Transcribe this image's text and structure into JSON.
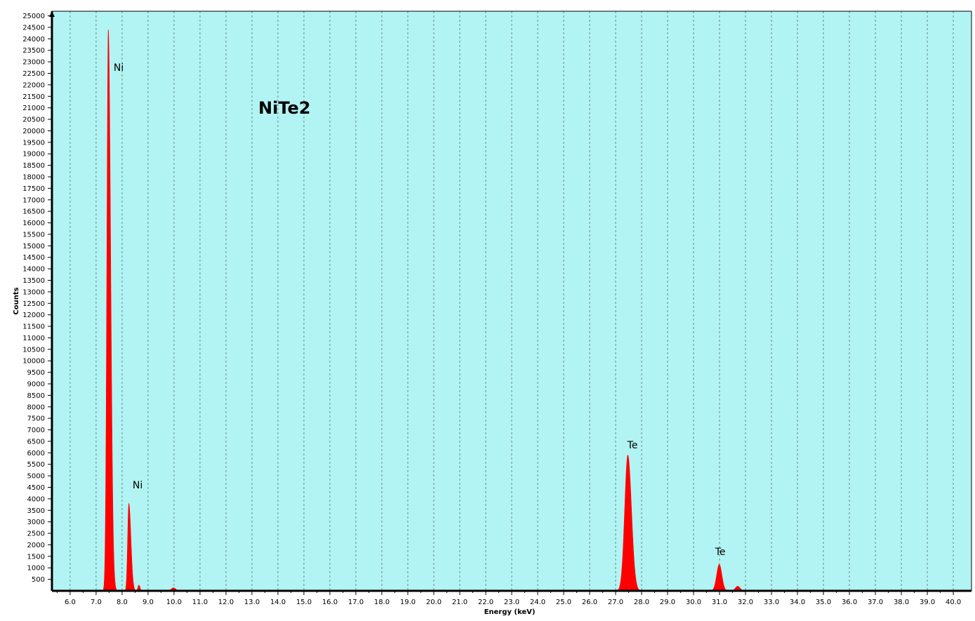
{
  "chart_data": {
    "type": "area",
    "title": "NiTe2",
    "xlabel": "Energy (keV)",
    "ylabel": "Counts",
    "xlim": [
      5.3,
      40.7
    ],
    "ylim": [
      0,
      25200
    ],
    "grid": true,
    "colors": {
      "plot_bg": "#b2f4f4",
      "fill": "#ff0000",
      "grid": "#6a8a8a"
    },
    "x_ticks": [
      "6.0",
      "7.0",
      "8.0",
      "9.0",
      "10.0",
      "11.0",
      "12.0",
      "13.0",
      "14.0",
      "15.0",
      "16.0",
      "17.0",
      "18.0",
      "19.0",
      "20.0",
      "21.0",
      "22.0",
      "23.0",
      "24.0",
      "25.0",
      "26.0",
      "27.0",
      "28.0",
      "29.0",
      "30.0",
      "31.0",
      "32.0",
      "33.0",
      "34.0",
      "35.0",
      "36.0",
      "37.0",
      "38.0",
      "39.0",
      "40.0"
    ],
    "y_ticks": [
      "500",
      "1000",
      "1500",
      "2000",
      "2500",
      "3000",
      "3500",
      "4000",
      "4500",
      "5000",
      "5500",
      "6000",
      "6500",
      "7000",
      "7500",
      "8000",
      "8500",
      "9000",
      "9500",
      "10000",
      "10500",
      "11000",
      "11500",
      "12000",
      "12500",
      "13000",
      "13500",
      "14000",
      "14500",
      "15000",
      "15500",
      "16000",
      "16500",
      "17000",
      "17500",
      "18000",
      "18500",
      "19000",
      "19500",
      "20000",
      "20500",
      "21000",
      "21500",
      "22000",
      "22500",
      "23000",
      "23500",
      "24000",
      "24500",
      "25000"
    ],
    "peaks": [
      {
        "x": 7.47,
        "y": 24400,
        "sigma": 0.055,
        "tail": 0.09
      },
      {
        "x": 8.26,
        "y": 3800,
        "sigma": 0.045,
        "tail": 0.08
      },
      {
        "x": 8.65,
        "y": 250,
        "sigma": 0.04,
        "tail": 0.04
      },
      {
        "x": 9.98,
        "y": 130,
        "sigma": 0.09,
        "tail": 0.09
      },
      {
        "x": 27.47,
        "y": 5900,
        "sigma": 0.12,
        "tail": 0.14
      },
      {
        "x": 30.99,
        "y": 1150,
        "sigma": 0.1,
        "tail": 0.1
      },
      {
        "x": 31.7,
        "y": 200,
        "sigma": 0.09,
        "tail": 0.09
      }
    ],
    "annotations": [
      {
        "text": "Ni",
        "x": 7.87,
        "y": 22600
      },
      {
        "text": "Ni",
        "x": 8.6,
        "y": 4450
      },
      {
        "text": "Te",
        "x": 27.65,
        "y": 6200
      },
      {
        "text": "Te",
        "x": 31.03,
        "y": 1550
      }
    ]
  }
}
